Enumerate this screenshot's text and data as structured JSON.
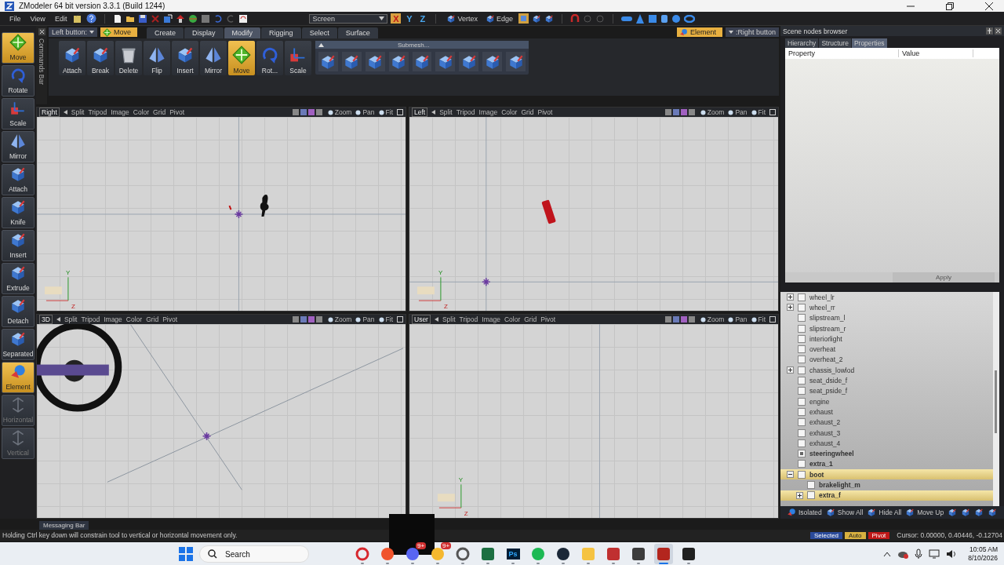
{
  "window": {
    "title": "ZModeler 64 bit version 3.3.1 (Build 1244)"
  },
  "menu": [
    "File",
    "View",
    "Edit"
  ],
  "toolbar": {
    "coordinate_space": "Screen",
    "axes": [
      {
        "label": "X",
        "selected": true
      },
      {
        "label": "Y",
        "selected": false
      },
      {
        "label": "Z",
        "selected": false
      }
    ],
    "modes": [
      {
        "label": "Vertex",
        "selected": false
      },
      {
        "label": "Edge",
        "selected": false
      }
    ]
  },
  "command_panel": {
    "commands_bar": "Commands Bar",
    "left_button_label": "Left button:",
    "left_button_tool": "Move",
    "right_button_tool": "Element",
    "right_button_label": ":Right button"
  },
  "left_tools": [
    {
      "label": "Move",
      "selected": true,
      "disabled": false
    },
    {
      "label": "Rotate",
      "selected": false,
      "disabled": false
    },
    {
      "label": "Scale",
      "selected": false,
      "disabled": false
    },
    {
      "label": "Mirror",
      "selected": false,
      "disabled": false
    },
    {
      "label": "Attach",
      "selected": false,
      "disabled": false
    },
    {
      "label": "Knife",
      "selected": false,
      "disabled": false
    },
    {
      "label": "Insert",
      "selected": false,
      "disabled": false
    },
    {
      "label": "Extrude",
      "selected": false,
      "disabled": false
    },
    {
      "label": "Detach",
      "selected": false,
      "disabled": false
    },
    {
      "label": "Separated",
      "selected": false,
      "disabled": false
    },
    {
      "label": "Element",
      "selected": true,
      "disabled": false
    },
    {
      "label": "Horizontal",
      "selected": false,
      "disabled": true
    },
    {
      "label": "Vertical",
      "selected": false,
      "disabled": true
    }
  ],
  "ribbon": {
    "tabs": [
      {
        "label": "Create",
        "selected": false
      },
      {
        "label": "Display",
        "selected": false
      },
      {
        "label": "Modify",
        "selected": true
      },
      {
        "label": "Rigging",
        "selected": false
      },
      {
        "label": "Select",
        "selected": false
      },
      {
        "label": "Surface",
        "selected": false
      }
    ],
    "tools": [
      {
        "label": "Attach",
        "selected": false
      },
      {
        "label": "Break",
        "selected": false
      },
      {
        "label": "Delete",
        "selected": false
      },
      {
        "label": "Flip",
        "selected": false
      },
      {
        "label": "Insert",
        "selected": false
      },
      {
        "label": "Mirror",
        "selected": false
      },
      {
        "label": "Move",
        "selected": true
      },
      {
        "label": "Rot...",
        "selected": false
      },
      {
        "label": "Scale",
        "selected": false
      }
    ],
    "group_title": "Submesh..."
  },
  "viewports": [
    {
      "name": "Right",
      "kind": "right",
      "menu": [
        "Split",
        "Tripod",
        "Image",
        "Color",
        "Grid",
        "Pivot"
      ],
      "controls": [
        "Zoom",
        "Pan",
        "Fit"
      ],
      "axes": [
        "Y",
        "Z"
      ]
    },
    {
      "name": "Left",
      "kind": "left",
      "menu": [
        "Split",
        "Tripod",
        "Image",
        "Color",
        "Grid",
        "Pivot"
      ],
      "controls": [
        "Zoom",
        "Pan",
        "Fit"
      ],
      "axes": [
        "Y",
        "Z"
      ]
    },
    {
      "name": "3D",
      "kind": "perspective",
      "menu": [
        "Split",
        "Tripod",
        "Image",
        "Color",
        "Grid",
        "Pivot"
      ],
      "controls": [
        "Zoom",
        "Pan",
        "Fit"
      ]
    },
    {
      "name": "User",
      "kind": "user",
      "menu": [
        "Split",
        "Tripod",
        "Image",
        "Color",
        "Grid",
        "Pivot"
      ],
      "controls": [
        "Zoom",
        "Pan",
        "Fit"
      ],
      "axes": [
        "Y",
        "Z"
      ]
    }
  ],
  "scene_browser": {
    "title": "Scene nodes browser",
    "tabs": [
      {
        "label": "Hierarchy",
        "selected": false
      },
      {
        "label": "Structure",
        "selected": false
      },
      {
        "label": "Properties",
        "selected": true
      }
    ],
    "columns": [
      "Property",
      "Value"
    ],
    "apply": "Apply",
    "tree": [
      {
        "label": "wheel_lr",
        "expanded": false,
        "checked": false,
        "bold": false,
        "selected": false
      },
      {
        "label": "wheel_rr",
        "expanded": false,
        "checked": false,
        "bold": false,
        "selected": false
      },
      {
        "label": "slipstream_l",
        "checked": false,
        "bold": false,
        "selected": false
      },
      {
        "label": "slipstream_r",
        "checked": false,
        "bold": false,
        "selected": false
      },
      {
        "label": "interiorlight",
        "checked": false,
        "bold": false,
        "selected": false
      },
      {
        "label": "overheat",
        "checked": false,
        "bold": false,
        "selected": false
      },
      {
        "label": "overheat_2",
        "checked": false,
        "bold": false,
        "selected": false
      },
      {
        "label": "chassis_lowlod",
        "expanded": false,
        "checked": false,
        "bold": false,
        "selected": false
      },
      {
        "label": "seat_dside_f",
        "checked": false,
        "bold": false,
        "selected": false
      },
      {
        "label": "seat_pside_f",
        "checked": false,
        "bold": false,
        "selected": false
      },
      {
        "label": "engine",
        "checked": false,
        "bold": false,
        "selected": false
      },
      {
        "label": "exhaust",
        "checked": false,
        "bold": false,
        "selected": false
      },
      {
        "label": "exhaust_2",
        "checked": false,
        "bold": false,
        "selected": false
      },
      {
        "label": "exhaust_3",
        "checked": false,
        "bold": false,
        "selected": false
      },
      {
        "label": "exhaust_4",
        "checked": false,
        "bold": false,
        "selected": false
      },
      {
        "label": "steeringwheel",
        "checked": true,
        "bold": true,
        "selected": false
      },
      {
        "label": "extra_1",
        "checked": false,
        "bold": true,
        "selected": false
      },
      {
        "label": "boot",
        "expanded": true,
        "checked": false,
        "bold": true,
        "selected": true,
        "children": [
          {
            "label": "brakelight_m",
            "checked": false,
            "bold": true,
            "selected": false
          },
          {
            "label": "extra_f",
            "expanded": false,
            "checked": false,
            "bold": true,
            "selected": true
          }
        ]
      }
    ],
    "actions": [
      "Isolated",
      "Show All",
      "Hide All",
      "Move Up"
    ]
  },
  "messaging_bar": "Messaging Bar",
  "status": {
    "message": "Holding Ctrl key down will constrain tool to vertical or horizontal movement only.",
    "indicators": [
      {
        "label": "Selected",
        "kind": "selection"
      },
      {
        "label": "Auto",
        "kind": "auto"
      },
      {
        "label": "Pivot",
        "kind": "pivot"
      }
    ],
    "cursor": "Cursor: 0.00000, 0.40446, -0.12704"
  },
  "taskbar": {
    "search": "Search",
    "time": "10:05 AM",
    "date": "8/10/2026",
    "apps": [
      {
        "kind": "ring",
        "color": "#d7282f",
        "selected": false
      },
      {
        "kind": "round",
        "color": "#f0542d",
        "selected": false
      },
      {
        "kind": "round",
        "color": "#5865f2",
        "badge": "9+",
        "selected": false
      },
      {
        "kind": "round",
        "color": "#f5b82e",
        "badge": "9+",
        "selected": false
      },
      {
        "kind": "ring",
        "color": "#555555",
        "selected": false
      },
      {
        "kind": "square",
        "color": "#1d6f42",
        "selected": false
      },
      {
        "kind": "text",
        "color": "#001e36",
        "label": "Ps",
        "selected": false
      },
      {
        "kind": "round",
        "color": "#1db954",
        "selected": false
      },
      {
        "kind": "round",
        "color": "#1b2838",
        "selected": false
      },
      {
        "kind": "square",
        "color": "#f5c342",
        "selected": false
      },
      {
        "kind": "square",
        "color": "#c03030",
        "selected": false
      },
      {
        "kind": "square",
        "color": "#3c3c3c",
        "selected": false
      },
      {
        "kind": "square",
        "color": "#b3261e",
        "selected": true
      },
      {
        "kind": "square",
        "color": "#202020",
        "selected": false
      }
    ]
  }
}
